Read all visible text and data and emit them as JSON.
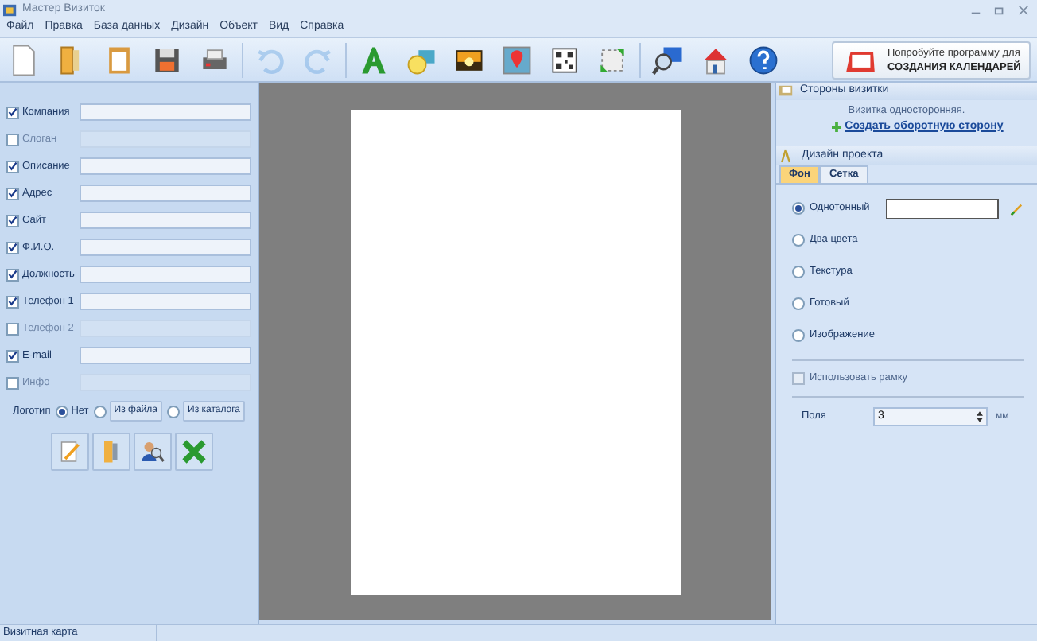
{
  "window": {
    "title": "Мастер Визиток"
  },
  "menu": [
    "Файл",
    "Правка",
    "База данных",
    "Дизайн",
    "Объект",
    "Вид",
    "Справка"
  ],
  "toolbar": {
    "undo_disabled": true,
    "redo_disabled": true
  },
  "promo": {
    "line1": "Попробуйте программу для",
    "line2": "СОЗДАНИЯ КАЛЕНДАРЕЙ"
  },
  "fields": [
    {
      "label": "Компания",
      "checked": true
    },
    {
      "label": "Слоган",
      "checked": false
    },
    {
      "label": "Описание",
      "checked": true
    },
    {
      "label": "Адрес",
      "checked": true
    },
    {
      "label": "Сайт",
      "checked": true
    },
    {
      "label": "Ф.И.О.",
      "checked": true
    },
    {
      "label": "Должность",
      "checked": true
    },
    {
      "label": "Телефон 1",
      "checked": true
    },
    {
      "label": "Телефон 2",
      "checked": false
    },
    {
      "label": "E-mail",
      "checked": true
    },
    {
      "label": "Инфо",
      "checked": false
    }
  ],
  "logo": {
    "label": "Логотип",
    "options": [
      {
        "label": "Нет",
        "kind": "radio",
        "selected": true
      },
      {
        "label": "Из файла",
        "kind": "button",
        "selected": false
      },
      {
        "label": "Из каталога",
        "kind": "button",
        "selected": false
      }
    ]
  },
  "sides": {
    "title": "Стороны визитки",
    "text": "Визитка односторонняя.",
    "link": "Создать оборотную сторону"
  },
  "design": {
    "title": "Дизайн проекта",
    "tabs": [
      {
        "label": "Фон",
        "selected": true
      },
      {
        "label": "Сетка",
        "selected": false
      }
    ],
    "fill_options": [
      {
        "label": "Однотонный",
        "selected": true
      },
      {
        "label": "Два цвета",
        "selected": false
      },
      {
        "label": "Текстура",
        "selected": false
      },
      {
        "label": "Готовый",
        "selected": false
      },
      {
        "label": "Изображение",
        "selected": false
      }
    ],
    "frame": {
      "label": "Использовать рамку",
      "checked": false
    },
    "margins": {
      "label": "Поля",
      "value": "3",
      "unit": "мм"
    }
  },
  "status_bar": "Визитная карта"
}
